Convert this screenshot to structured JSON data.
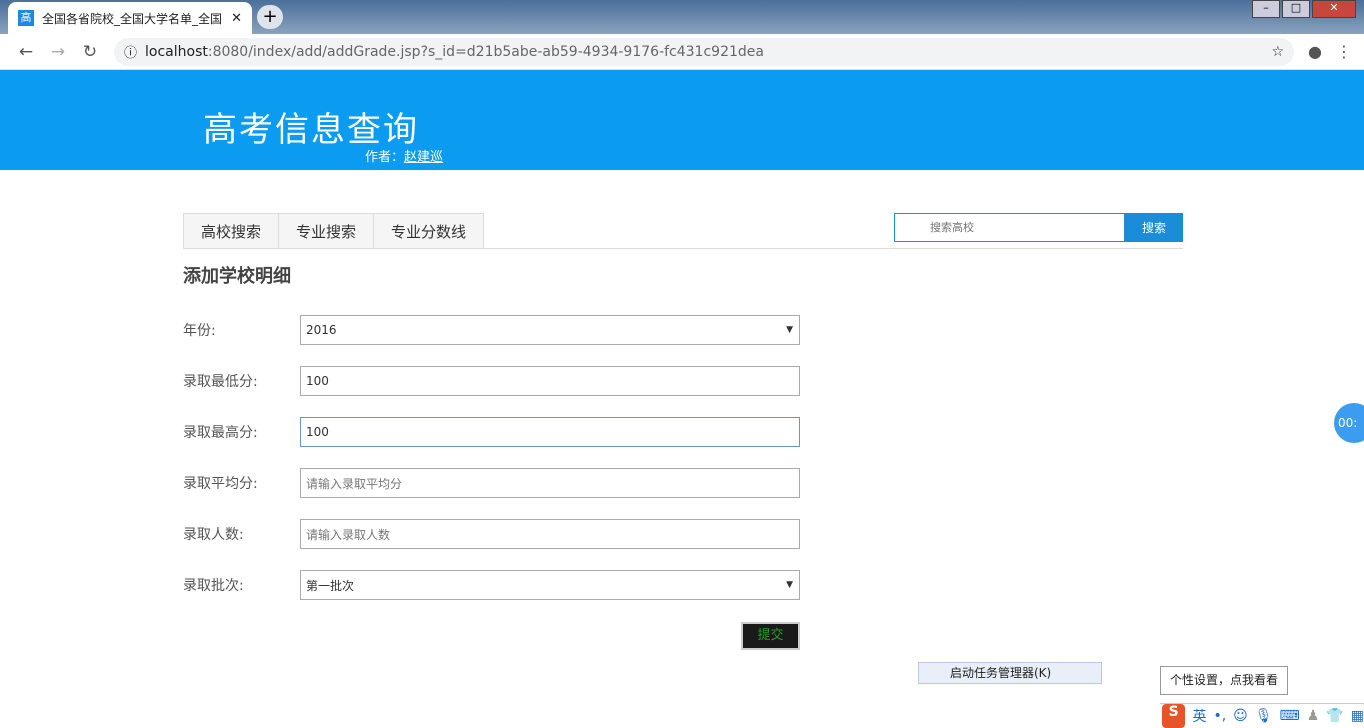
{
  "browser": {
    "tab_title": "全国各省院校_全国大学名单_全国",
    "favicon": "高",
    "url_host": "localhost",
    "url_path": ":8080/index/add/addGrade.jsp?s_id=d21b5abe-ab59-4934-9176-fc431c921dea"
  },
  "header": {
    "title": "高考信息查询",
    "author_label": "作者：",
    "author_name": "赵建巡"
  },
  "nav": {
    "tabs": [
      "高校搜索",
      "专业搜索",
      "专业分数线"
    ]
  },
  "search": {
    "placeholder": "搜索高校",
    "button": "搜索"
  },
  "form": {
    "title": "添加学校明细",
    "fields": [
      {
        "label": "年份:",
        "value": "2016",
        "type": "select"
      },
      {
        "label": "录取最低分:",
        "value": "100"
      },
      {
        "label": "录取最高分:",
        "value": "100"
      },
      {
        "label": "录取平均分:",
        "placeholder": "请输入录取平均分"
      },
      {
        "label": "录取人数:",
        "placeholder": "请输入录取人数"
      },
      {
        "label": "录取批次:",
        "value": "第一批次",
        "type": "select"
      }
    ],
    "submit": "提交"
  },
  "overlay": {
    "task_manager": "启动任务管理器(K)",
    "ime_tooltip": "个性设置，点我看看",
    "ime_mode": "英",
    "float_timer": "00:"
  }
}
